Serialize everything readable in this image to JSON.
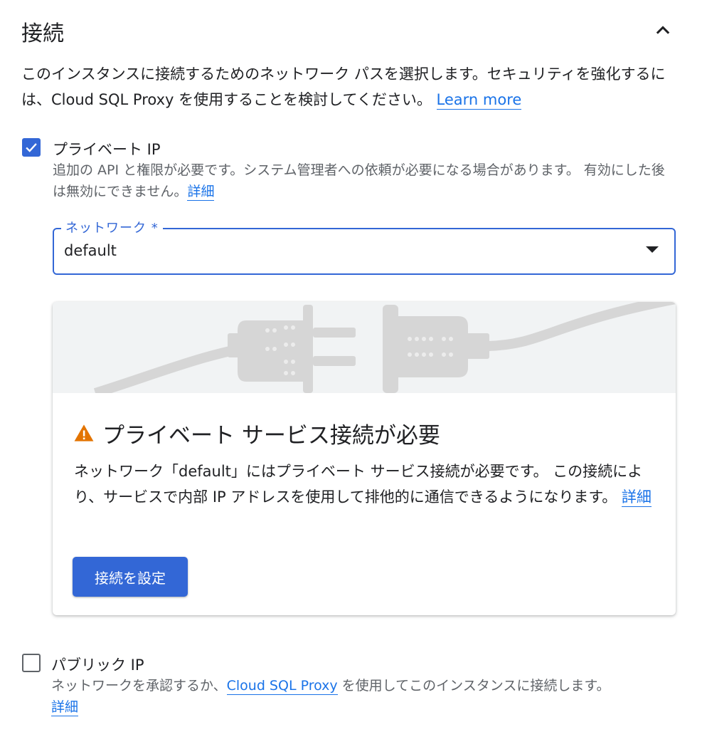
{
  "header": {
    "title": "接続",
    "collapse_icon": "chevron-up-icon"
  },
  "intro": {
    "text": "このインスタンスに接続するためのネットワーク パスを選択します。セキュリティを強化するには、Cloud SQL Proxy を使用することを検討してください。",
    "link": "Learn more"
  },
  "private_ip": {
    "checked": true,
    "label": "プライベート IP",
    "description": "追加の API と権限が必要です。システム管理者への依頼が必要になる場合があります。 有効にした後は無効にできません。",
    "link": "詳細"
  },
  "network_select": {
    "label": "ネットワーク *",
    "value": "default"
  },
  "warning_card": {
    "illustration": "plug-disconnected-illustration",
    "icon": "warning-icon",
    "title": "プライベート サービス接続が必要",
    "body": "ネットワーク「default」にはプライベート サービス接続が必要です。 この接続により、サービスで内部 IP アドレスを使用して排他的に通信できるようになります。",
    "link": "詳細",
    "button": "接続を設定"
  },
  "public_ip": {
    "checked": false,
    "label": "パブリック IP",
    "description_before": "ネットワークを承認するか、",
    "description_link": "Cloud SQL Proxy",
    "description_after": "を使用してこのインスタンスに接続します。",
    "link": "詳細"
  },
  "colors": {
    "primary": "#3367d6",
    "link": "#1a73e8",
    "warning": "#e37400",
    "text": "#202124",
    "secondary_text": "#5f6368"
  }
}
